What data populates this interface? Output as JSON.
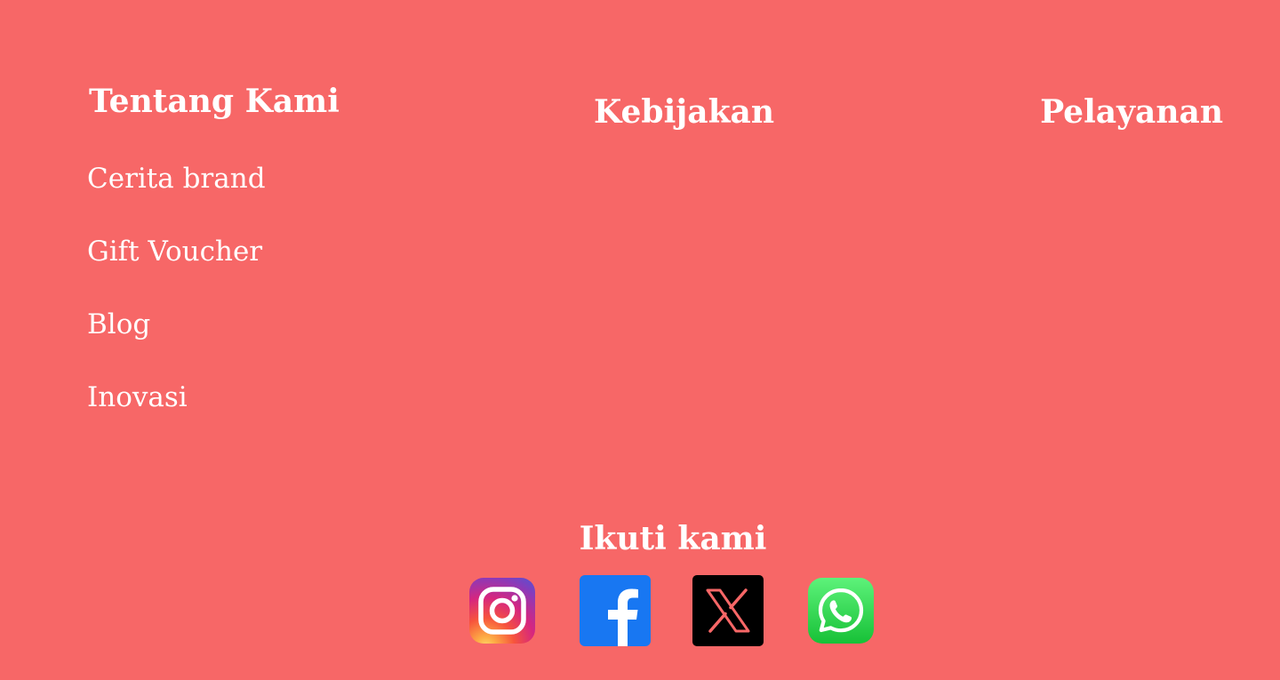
{
  "footer": {
    "columns": {
      "about": {
        "heading": "Tentang Kami",
        "links": [
          "Cerita brand",
          "Gift Voucher",
          "Blog",
          "Inovasi"
        ]
      },
      "policy": {
        "heading": "Kebijakan"
      },
      "service": {
        "heading": "Pelayanan"
      }
    },
    "follow": {
      "heading": "Ikuti kami",
      "social": [
        {
          "name": "Instagram",
          "icon": "instagram-icon"
        },
        {
          "name": "Facebook",
          "icon": "facebook-icon"
        },
        {
          "name": "X",
          "icon": "x-icon"
        },
        {
          "name": "WhatsApp",
          "icon": "whatsapp-icon"
        }
      ]
    }
  },
  "colors": {
    "background": "#f76767",
    "text": "#ffffff",
    "facebook": "#1877f2",
    "whatsapp": "#25d366"
  }
}
